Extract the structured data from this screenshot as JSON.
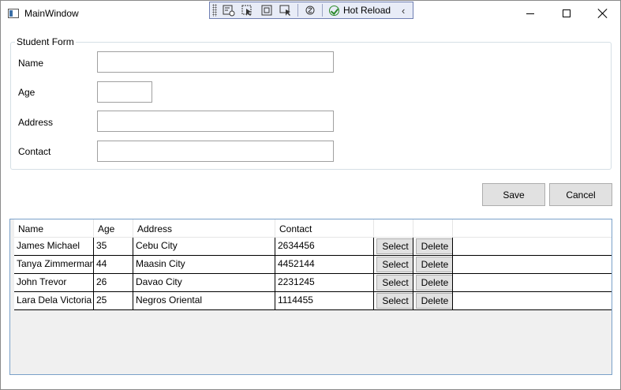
{
  "window": {
    "title": "MainWindow"
  },
  "hot_reload": {
    "label": "Hot Reload"
  },
  "form": {
    "group_title": "Student Form",
    "fields": [
      {
        "label": "Name",
        "value": ""
      },
      {
        "label": "Age",
        "value": ""
      },
      {
        "label": "Address",
        "value": ""
      },
      {
        "label": "Contact",
        "value": ""
      }
    ]
  },
  "actions": {
    "save_label": "Save",
    "cancel_label": "Cancel"
  },
  "grid": {
    "headers": [
      "Name",
      "Age",
      "Address",
      "Contact"
    ],
    "select_label": "Select",
    "delete_label": "Delete",
    "rows": [
      {
        "name": "James Michael",
        "age": "35",
        "address": "Cebu City",
        "contact": "2634456"
      },
      {
        "name": "Tanya Zimmerman",
        "age": "44",
        "address": "Maasin City",
        "contact": "4452144"
      },
      {
        "name": "John Trevor",
        "age": "26",
        "address": "Davao City",
        "contact": "2231245"
      },
      {
        "name": "Lara Dela Victoria",
        "age": "25",
        "address": "Negros Oriental",
        "contact": "1114455"
      }
    ]
  }
}
